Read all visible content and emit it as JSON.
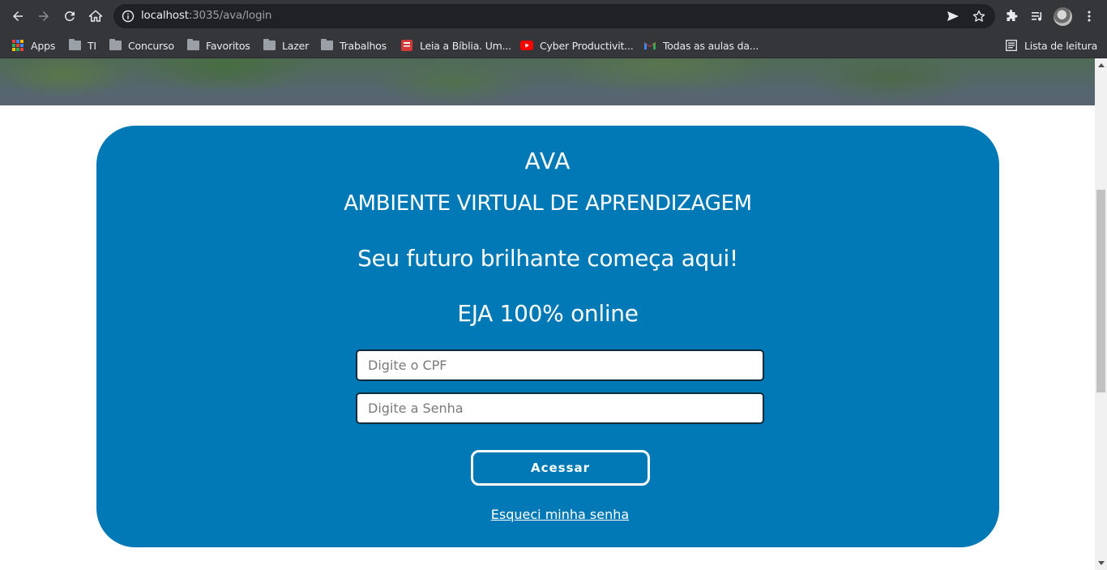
{
  "browser": {
    "url_host": "localhost",
    "url_rest": ":3035/ava/login",
    "bookmarks": [
      {
        "label": "Apps",
        "icon": "apps-grid-icon"
      },
      {
        "label": "TI",
        "icon": "folder-icon"
      },
      {
        "label": "Concurso",
        "icon": "folder-icon"
      },
      {
        "label": "Favoritos",
        "icon": "folder-icon"
      },
      {
        "label": "Lazer",
        "icon": "folder-icon"
      },
      {
        "label": "Trabalhos",
        "icon": "folder-icon"
      },
      {
        "label": "Leia a Bíblia. Um...",
        "icon": "bible-app-icon"
      },
      {
        "label": "Cyber Productivit...",
        "icon": "youtube-icon"
      },
      {
        "label": "Todas as aulas da...",
        "icon": "gmail-icon"
      }
    ],
    "reading_list": "Lista de leitura"
  },
  "login": {
    "title": "AVA",
    "subtitle": "AMBIENTE VIRTUAL DE APRENDIZAGEM",
    "slogan": "Seu futuro brilhante começa aqui!",
    "program": "EJA 100% online",
    "cpf_placeholder": "Digite o CPF",
    "password_placeholder": "Digite a Senha",
    "submit_label": "Acessar",
    "forgot_label": "Esqueci minha senha"
  },
  "colors": {
    "card": "#0079b6",
    "chrome": "#35363a",
    "omnibox": "#202124"
  }
}
